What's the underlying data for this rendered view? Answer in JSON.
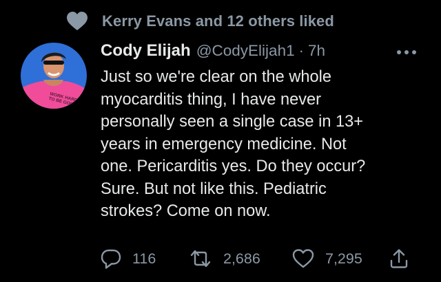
{
  "social_context": {
    "text": "Kerry Evans and 12 others liked",
    "icon": "heart-icon"
  },
  "tweet": {
    "author_name": "Cody Elijah",
    "handle": "@CodyElijah1",
    "separator": "·",
    "time": "7h",
    "body": "Just so we're clear on the whole\nmyocarditis thing, I have never\npersonally seen a single case in 13+\nyears in emergency medicine. Not\none. Pericarditis yes. Do they occur?\nSure. But not like this. Pediatric\nstrokes? Come on now.",
    "avatar_shirt_text": "WORK HARD\nTO BE GOOD",
    "more_icon": "more-horizontal-icon"
  },
  "actions": {
    "reply": {
      "icon": "reply-icon",
      "count": "116"
    },
    "retweet": {
      "icon": "retweet-icon",
      "count": "2,686"
    },
    "like": {
      "icon": "heart-outline-icon",
      "count": "7,295"
    },
    "share": {
      "icon": "share-icon"
    }
  },
  "colors": {
    "background": "#000000",
    "primary_text": "#e7e9ea",
    "secondary_text": "#8b98a5",
    "avatar_sky": "#2f6fd8",
    "avatar_shirt": "#f04c9a"
  }
}
